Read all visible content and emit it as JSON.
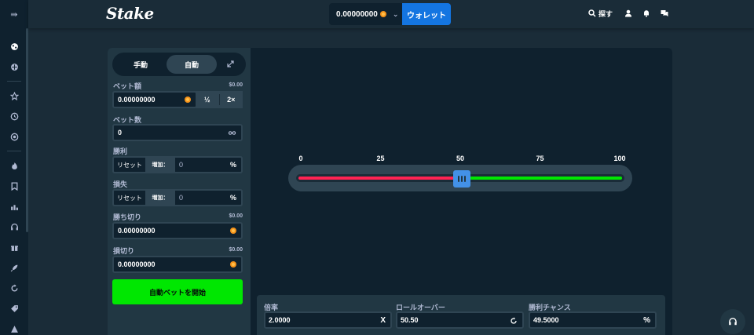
{
  "header": {
    "logo": "Stake",
    "balance": "0.00000000",
    "wallet_label": "ウォレット",
    "search_label": "探す"
  },
  "bet_panel": {
    "tabs": {
      "manual": "手動",
      "auto": "自動"
    },
    "bet_amount": {
      "label": "ベット額",
      "usd": "$0.00",
      "value": "0.00000000",
      "half": "½",
      "double": "2×"
    },
    "bet_count": {
      "label": "ベット数",
      "value": "0"
    },
    "on_win": {
      "label": "勝利",
      "reset": "リセット",
      "increase": "増加：",
      "value": "0",
      "unit": "%"
    },
    "on_loss": {
      "label": "損失",
      "reset": "リセット",
      "increase": "増加：",
      "value": "0",
      "unit": "%"
    },
    "stop_profit": {
      "label": "勝ち切り",
      "usd": "$0.00",
      "value": "0.00000000"
    },
    "stop_loss": {
      "label": "損切り",
      "usd": "$0.00",
      "value": "0.00000000"
    },
    "start_label": "自動ベットを開始"
  },
  "slider": {
    "ticks": [
      "0",
      "25",
      "50",
      "75",
      "100"
    ],
    "value": 50.5,
    "colors": {
      "lose": "#ff2353",
      "win": "#00e701",
      "knob": "#4391e7"
    }
  },
  "stats": {
    "multiplier": {
      "label": "倍率",
      "value": "2.0000",
      "icon": "X"
    },
    "roll_over": {
      "label": "ロールオーバー",
      "value": "50.50"
    },
    "win_chance": {
      "label": "勝利チャンス",
      "value": "49.5000",
      "icon": "%"
    }
  },
  "colors": {
    "accent": "#1475e1",
    "start": "#00e701",
    "bg": "#1a2c38",
    "panel": "#213743",
    "dark": "#0f212e"
  }
}
